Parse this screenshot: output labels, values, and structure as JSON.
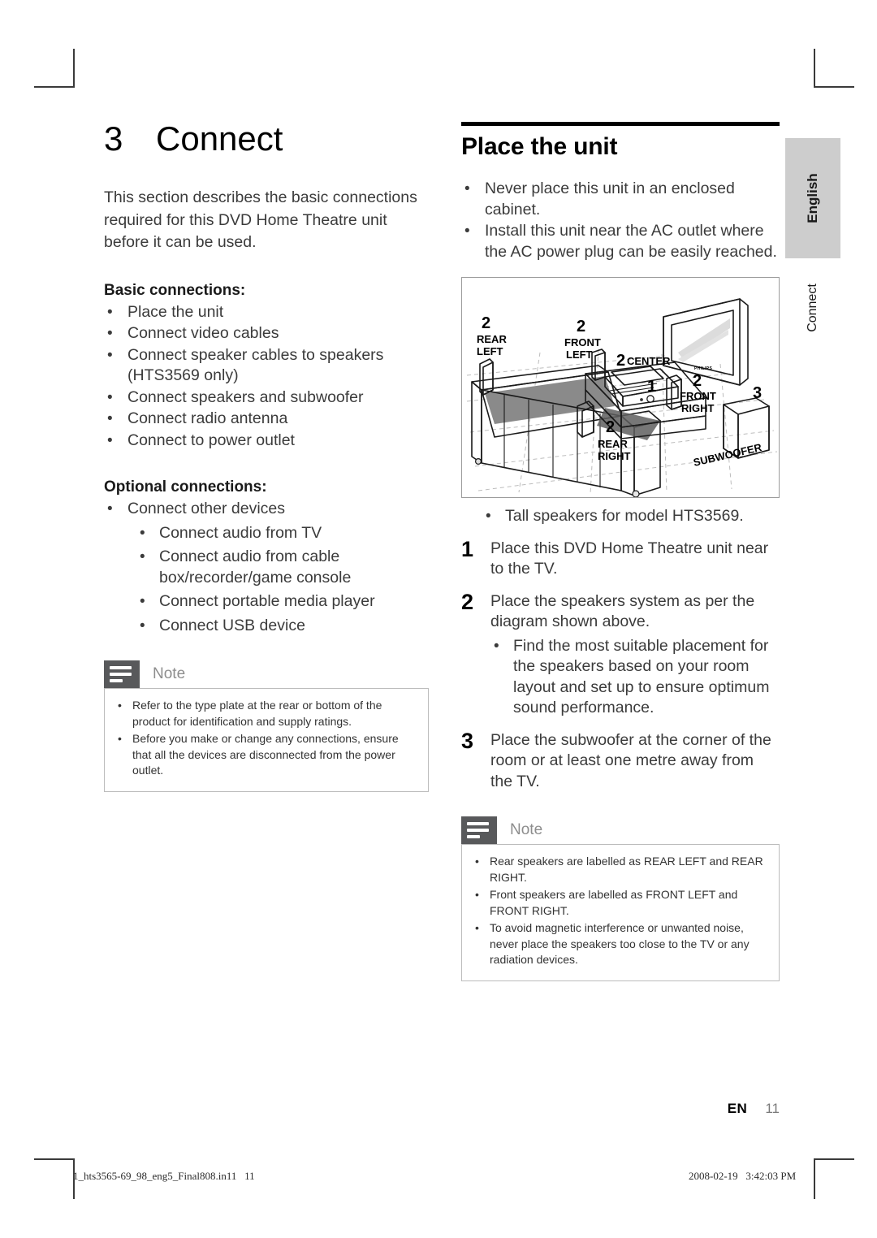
{
  "chapter": {
    "number": "3",
    "title": "Connect",
    "intro": "This section describes the basic connections required for this DVD Home Theatre unit before it can be used."
  },
  "basic": {
    "heading": "Basic connections:",
    "items": [
      "Place the unit",
      "Connect video cables",
      "Connect speaker cables to speakers (HTS3569 only)",
      "Connect speakers and subwoofer",
      "Connect radio antenna",
      "Connect to power outlet"
    ]
  },
  "optional": {
    "heading": "Optional connections:",
    "items": [
      "Connect other devices"
    ],
    "subitems": [
      "Connect audio from TV",
      "Connect audio from cable box/recorder/game console",
      "Connect portable media player",
      "Connect USB device"
    ]
  },
  "note_left": {
    "label": "Note",
    "icon": "note-lines-icon",
    "items": [
      "Refer to the type plate at the rear or bottom of the product for identification and supply ratings.",
      "Before you make or change any connections, ensure that all the devices are disconnected from the power outlet."
    ]
  },
  "section": {
    "title": "Place the unit",
    "bullets": [
      "Never place this unit in an enclosed cabinet.",
      "Install this unit near the AC outlet where the AC power plug can be easily reached."
    ]
  },
  "figure": {
    "name": "speaker-placement-diagram",
    "labels": {
      "rear_left_num": "2",
      "rear_left": "REAR\nLEFT",
      "rear_left_l1": "REAR",
      "rear_left_l2": "LEFT",
      "front_left_num": "2",
      "front_left_l1": "FRONT",
      "front_left_l2": "LEFT",
      "center_num": "2",
      "center": "CENTER",
      "unit_num": "1",
      "front_right_num": "2",
      "front_right_l1": "FRONT",
      "front_right_l2": "RIGHT",
      "rear_right_num": "2",
      "rear_right_l1": "REAR",
      "rear_right_l2": "RIGHT",
      "subwoofer_num": "3",
      "subwoofer": "SUBWOOFER",
      "tv_brand": "PHILIPS"
    }
  },
  "tall_speaker_note": "Tall speakers for model HTS3569.",
  "steps": [
    {
      "num": "1",
      "text": "Place this DVD Home Theatre unit near to the TV."
    },
    {
      "num": "2",
      "text": "Place the speakers system as per the diagram shown above."
    },
    {
      "num": "3",
      "text": "Place the subwoofer at the corner of the room or at least one metre away from the TV."
    }
  ],
  "step2_sub": "Find the most suitable placement for the speakers based on your room layout and set up to ensure optimum sound performance.",
  "note_right": {
    "label": "Note",
    "icon": "note-lines-icon",
    "items": [
      "Rear speakers are labelled as REAR LEFT and REAR RIGHT.",
      "Front speakers are labelled as FRONT LEFT and FRONT RIGHT.",
      "To avoid magnetic interference or unwanted noise, never place the speakers too close to the TV or any radiation devices."
    ]
  },
  "sidetab": {
    "language": "English",
    "chapter": "Connect"
  },
  "pagenumber": {
    "lang": "EN",
    "number": "11"
  },
  "footer": {
    "file": "1_hts3565-69_98_eng5_Final808.in11   11",
    "timestamp": "2008-02-19   3:42:03 PM"
  },
  "colors": {
    "note_icon_bg": "#58595b",
    "note_border": "#bcbcbc",
    "sidetab_bg": "#cdcdcd",
    "rule": "#000000",
    "body_text": "#3b3b3b"
  }
}
